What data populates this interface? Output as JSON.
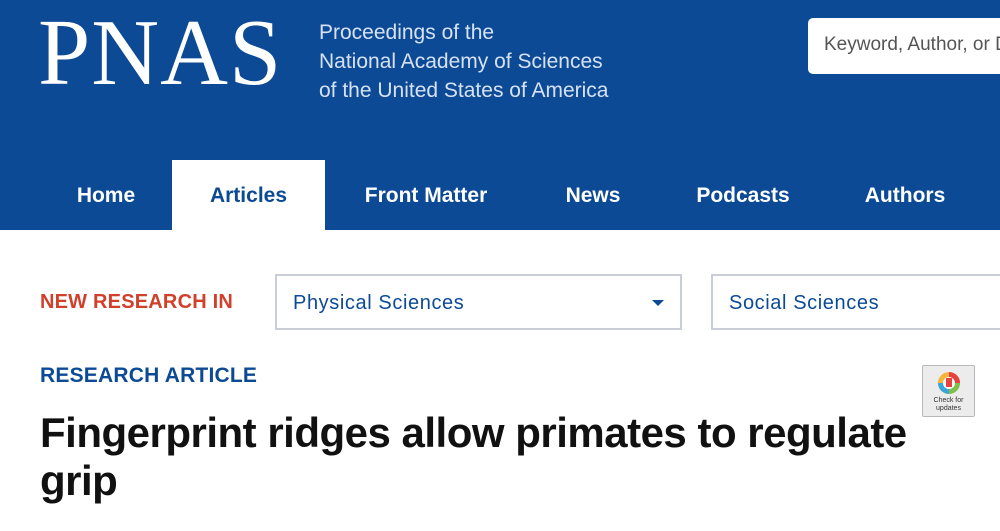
{
  "header": {
    "logo": "PNAS",
    "tagline": [
      "Proceedings of the",
      "National Academy of Sciences",
      "of the United States of America"
    ],
    "search_placeholder": "Keyword, Author, or DOI"
  },
  "nav": {
    "items": [
      {
        "label": "Home",
        "active": false
      },
      {
        "label": "Articles",
        "active": true
      },
      {
        "label": "Front Matter",
        "active": false
      },
      {
        "label": "News",
        "active": false
      },
      {
        "label": "Podcasts",
        "active": false
      },
      {
        "label": "Authors",
        "active": false
      }
    ]
  },
  "filters": {
    "label": "NEW RESEARCH IN",
    "selects": [
      {
        "value": "Physical Sciences"
      },
      {
        "value": "Social Sciences"
      }
    ]
  },
  "article": {
    "type": "RESEARCH ARTICLE",
    "title": "Fingerprint ridges allow primates to regulate grip"
  },
  "badge": {
    "line1": "Check for",
    "line2": "updates"
  },
  "colors": {
    "brand_blue": "#0c4a96",
    "accent_red": "#d0402a"
  }
}
